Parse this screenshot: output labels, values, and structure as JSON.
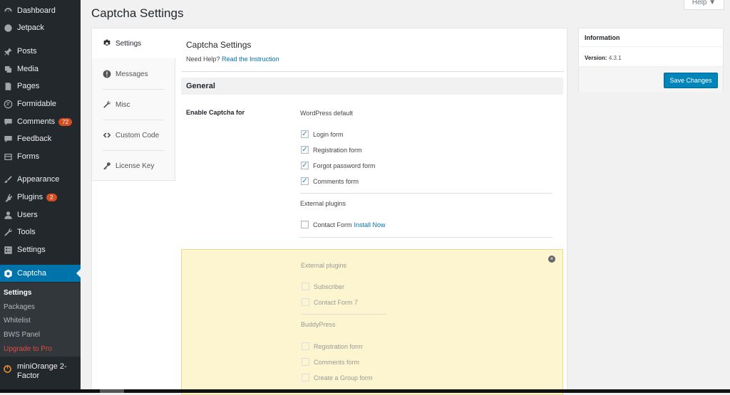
{
  "sidebar": {
    "items": [
      {
        "label": "Dashboard",
        "icon": "dashboard-icon"
      },
      {
        "label": "Jetpack",
        "icon": "jetpack-icon"
      },
      {
        "label": "Posts",
        "icon": "pin-icon"
      },
      {
        "label": "Media",
        "icon": "media-icon"
      },
      {
        "label": "Pages",
        "icon": "page-icon"
      },
      {
        "label": "Formidable",
        "icon": "formidable-icon"
      },
      {
        "label": "Comments",
        "icon": "comment-icon",
        "badge": "72"
      },
      {
        "label": "Feedback",
        "icon": "feedback-icon"
      },
      {
        "label": "Forms",
        "icon": "forms-icon"
      },
      {
        "label": "Appearance",
        "icon": "brush-icon"
      },
      {
        "label": "Plugins",
        "icon": "plugin-icon",
        "badge": "2"
      },
      {
        "label": "Users",
        "icon": "user-icon"
      },
      {
        "label": "Tools",
        "icon": "wrench-icon"
      },
      {
        "label": "Settings",
        "icon": "settings-icon"
      },
      {
        "label": "Captcha",
        "icon": "captcha-icon",
        "active": true
      }
    ],
    "submenu": [
      "Settings",
      "Packages",
      "Whitelist",
      "BWS Panel",
      "Upgrade to Pro"
    ],
    "miniorange": {
      "line1": "miniOrange 2-",
      "line2": "Factor"
    }
  },
  "page_title": "Captcha Settings",
  "help_label": "Help ▼",
  "tabs": [
    "Settings",
    "Messages",
    "Misc",
    "Custom Code",
    "License Key"
  ],
  "content": {
    "title": "Captcha Settings",
    "need_help": "Need Help?",
    "instruction_link": "Read the Instruction",
    "section": "General",
    "enable_label": "Enable Captcha for",
    "wp_default": "WordPress default",
    "wp_options": [
      "Login form",
      "Registration form",
      "Forgot password form",
      "Comments form"
    ],
    "external_title": "External plugins",
    "contact_form": "Contact Form",
    "install_now": "Install Now"
  },
  "pro": {
    "external_title": "External plugins",
    "external_options": [
      "Subscriber",
      "Contact Form 7"
    ],
    "buddypress_title": "BuddyPress",
    "buddypress_options": [
      "Registration form",
      "Comments form",
      "Create a Group form"
    ],
    "close_icon": "×"
  },
  "info": {
    "title": "Information",
    "version_label": "Version:",
    "version_value": "4.3.1",
    "save_label": "Save Changes"
  },
  "colors": {
    "accent": "#0073aa",
    "sidebar_bg": "#23282d",
    "pro_bg": "#fcf5d0",
    "badge": "#d54e21"
  }
}
